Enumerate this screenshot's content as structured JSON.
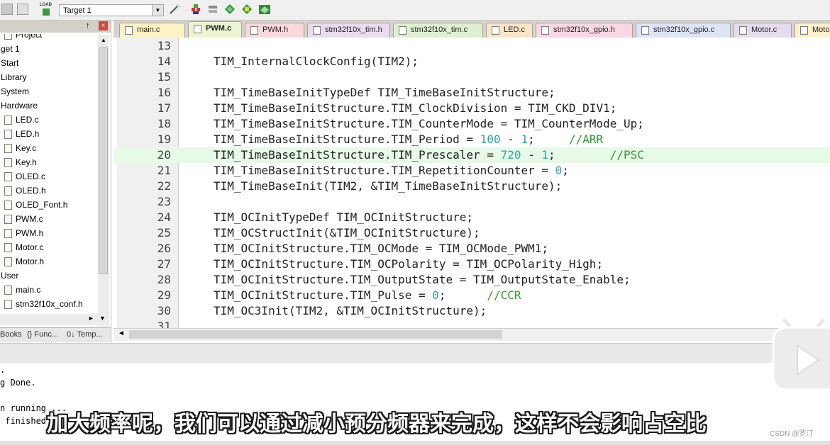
{
  "toolbar": {
    "target_value": "Target 1",
    "load_label": "LOAD",
    "icons": [
      "translate-icon",
      "build-icon",
      "load-icon",
      "target-options-icon",
      "magic-wand-icon",
      "manage-components-icon",
      "rte-icon",
      "pack-installer-icon",
      "diamond-icon",
      "packs-icon"
    ]
  },
  "project": {
    "title": "Project",
    "pin": "↑",
    "close": "×",
    "items": [
      {
        "label": "Project",
        "indent": 4
      },
      {
        "label": "get 1",
        "indent": 0
      },
      {
        "label": "Start",
        "indent": 0
      },
      {
        "label": "Library",
        "indent": 0
      },
      {
        "label": "System",
        "indent": 0
      },
      {
        "label": "Hardware",
        "indent": 0
      },
      {
        "label": "LED.c",
        "indent": 1
      },
      {
        "label": "LED.h",
        "indent": 1
      },
      {
        "label": "Key.c",
        "indent": 1
      },
      {
        "label": "Key.h",
        "indent": 1
      },
      {
        "label": "OLED.c",
        "indent": 1
      },
      {
        "label": "OLED.h",
        "indent": 1
      },
      {
        "label": "OLED_Font.h",
        "indent": 1
      },
      {
        "label": "PWM.c",
        "indent": 1
      },
      {
        "label": "PWM.h",
        "indent": 1
      },
      {
        "label": "Motor.c",
        "indent": 1
      },
      {
        "label": "Motor.h",
        "indent": 1
      },
      {
        "label": "User",
        "indent": 0
      },
      {
        "label": "main.c",
        "indent": 1
      },
      {
        "label": "stm32f10x_conf.h",
        "indent": 1
      }
    ],
    "bottom_tabs": [
      "Books",
      "{} Func...",
      "0↓ Temp..."
    ]
  },
  "tabs": [
    {
      "label": "main.c",
      "color": "#fdf2c4",
      "active": false
    },
    {
      "label": "PWM.c",
      "color": "#eaf6cf",
      "active": true
    },
    {
      "label": "PWM.h",
      "color": "#fbd8dc",
      "active": false
    },
    {
      "label": "stm32f10x_tim.h",
      "color": "#e9dcf0",
      "active": false
    },
    {
      "label": "stm32f10x_tim.c",
      "color": "#dff0d0",
      "active": false
    },
    {
      "label": "LED.c",
      "color": "#fbe5c8",
      "active": false
    },
    {
      "label": "stm32f10x_gpio.h",
      "color": "#fad7e4",
      "active": false
    },
    {
      "label": "stm32f10x_gpio.c",
      "color": "#dde4f6",
      "active": false
    },
    {
      "label": "Motor.c",
      "color": "#e6dcee",
      "active": false
    },
    {
      "label": "Motor.h",
      "color": "#fdf0cc",
      "active": false
    }
  ],
  "code": {
    "lines": [
      {
        "n": "13",
        "parts": []
      },
      {
        "n": "14",
        "parts": [
          {
            "t": "TIM_InternalClockConfig(TIM2);",
            "c": ""
          }
        ]
      },
      {
        "n": "15",
        "parts": []
      },
      {
        "n": "16",
        "parts": [
          {
            "t": "TIM_TimeBaseInitTypeDef TIM_TimeBaseInitStructure;",
            "c": ""
          }
        ]
      },
      {
        "n": "17",
        "parts": [
          {
            "t": "TIM_TimeBaseInitStructure.TIM_ClockDivision = TIM_CKD_DIV1;",
            "c": ""
          }
        ]
      },
      {
        "n": "18",
        "parts": [
          {
            "t": "TIM_TimeBaseInitStructure.TIM_CounterMode = TIM_CounterMode_Up;",
            "c": ""
          }
        ]
      },
      {
        "n": "19",
        "parts": [
          {
            "t": "TIM_TimeBaseInitStructure.TIM_Period = ",
            "c": ""
          },
          {
            "t": "100",
            "c": "num"
          },
          {
            "t": " - ",
            "c": ""
          },
          {
            "t": "1",
            "c": "num"
          },
          {
            "t": ";     ",
            "c": ""
          },
          {
            "t": "//ARR",
            "c": "cmt"
          }
        ]
      },
      {
        "n": "20",
        "parts": [
          {
            "t": "TIM_TimeBaseInitStructure.TIM_Prescaler = ",
            "c": ""
          },
          {
            "t": "720",
            "c": "num"
          },
          {
            "t": " - ",
            "c": ""
          },
          {
            "t": "1",
            "c": "num"
          },
          {
            "t": ";        ",
            "c": ""
          },
          {
            "t": "//PSC",
            "c": "cmt"
          }
        ],
        "highlight": true
      },
      {
        "n": "21",
        "parts": [
          {
            "t": "TIM_TimeBaseInitStructure.TIM_RepetitionCounter = ",
            "c": ""
          },
          {
            "t": "0",
            "c": "num"
          },
          {
            "t": ";",
            "c": ""
          }
        ]
      },
      {
        "n": "22",
        "parts": [
          {
            "t": "TIM_TimeBaseInit(TIM2, &TIM_TimeBaseInitStructure);",
            "c": ""
          }
        ]
      },
      {
        "n": "23",
        "parts": []
      },
      {
        "n": "24",
        "parts": [
          {
            "t": "TIM_OCInitTypeDef TIM_OCInitStructure;",
            "c": ""
          }
        ]
      },
      {
        "n": "25",
        "parts": [
          {
            "t": "TIM_OCStructInit(&TIM_OCInitStructure);",
            "c": ""
          }
        ]
      },
      {
        "n": "26",
        "parts": [
          {
            "t": "TIM_OCInitStructure.TIM_OCMode = TIM_OCMode_PWM1;",
            "c": ""
          }
        ]
      },
      {
        "n": "27",
        "parts": [
          {
            "t": "TIM_OCInitStructure.TIM_OCPolarity = TIM_OCPolarity_High;",
            "c": ""
          }
        ]
      },
      {
        "n": "28",
        "parts": [
          {
            "t": "TIM_OCInitStructure.TIM_OutputState = TIM_OutputState_Enable;",
            "c": ""
          }
        ]
      },
      {
        "n": "29",
        "parts": [
          {
            "t": "TIM_OCInitStructure.TIM_Pulse = ",
            "c": ""
          },
          {
            "t": "0",
            "c": "num"
          },
          {
            "t": ";      ",
            "c": ""
          },
          {
            "t": "//CCR",
            "c": "cmt"
          }
        ]
      },
      {
        "n": "30",
        "parts": [
          {
            "t": "TIM_OC3Init(TIM2, &TIM_OCInitStructure);",
            "c": ""
          }
        ]
      },
      {
        "n": "31",
        "parts": []
      }
    ]
  },
  "output": {
    "lines": [
      ".",
      "g Done.",
      "",
      "n running ...",
      " finished"
    ]
  },
  "subtitle": "加大频率呢，我们可以通过减小预分频器来完成，这样不会影响占空比",
  "watermark": "CSDN @罗汀"
}
